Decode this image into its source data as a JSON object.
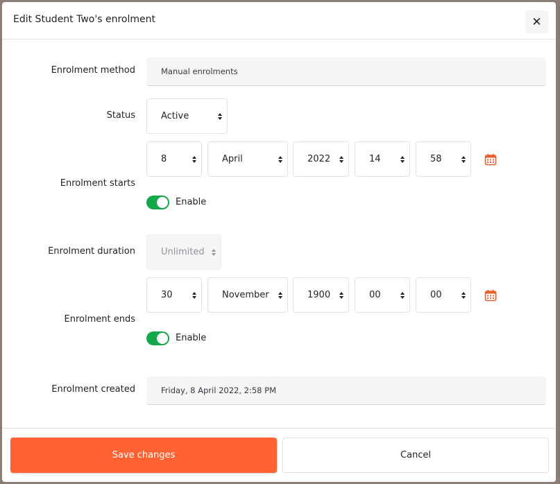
{
  "modal": {
    "title": "Edit Student Two's enrolment",
    "close_icon": "close-icon"
  },
  "fields": {
    "method": {
      "label": "Enrolment method",
      "value": "Manual enrolments"
    },
    "status": {
      "label": "Status",
      "value": "Active"
    },
    "starts": {
      "label": "Enrolment starts",
      "day": "8",
      "month": "April",
      "year": "2022",
      "hour": "14",
      "minute": "58",
      "enable_label": "Enable",
      "enabled": true
    },
    "duration": {
      "label": "Enrolment duration",
      "value": "Unlimited"
    },
    "ends": {
      "label": "Enrolment ends",
      "day": "30",
      "month": "November",
      "year": "1900",
      "hour": "00",
      "minute": "00",
      "enable_label": "Enable",
      "enabled": true
    },
    "created": {
      "label": "Enrolment created",
      "value": "Friday, 8 April 2022, 2:58 PM"
    }
  },
  "footer": {
    "save_label": "Save changes",
    "cancel_label": "Cancel"
  },
  "colors": {
    "primary": "#ff6333",
    "toggle_on": "#15a84a",
    "calendar_icon": "#e8602c"
  }
}
